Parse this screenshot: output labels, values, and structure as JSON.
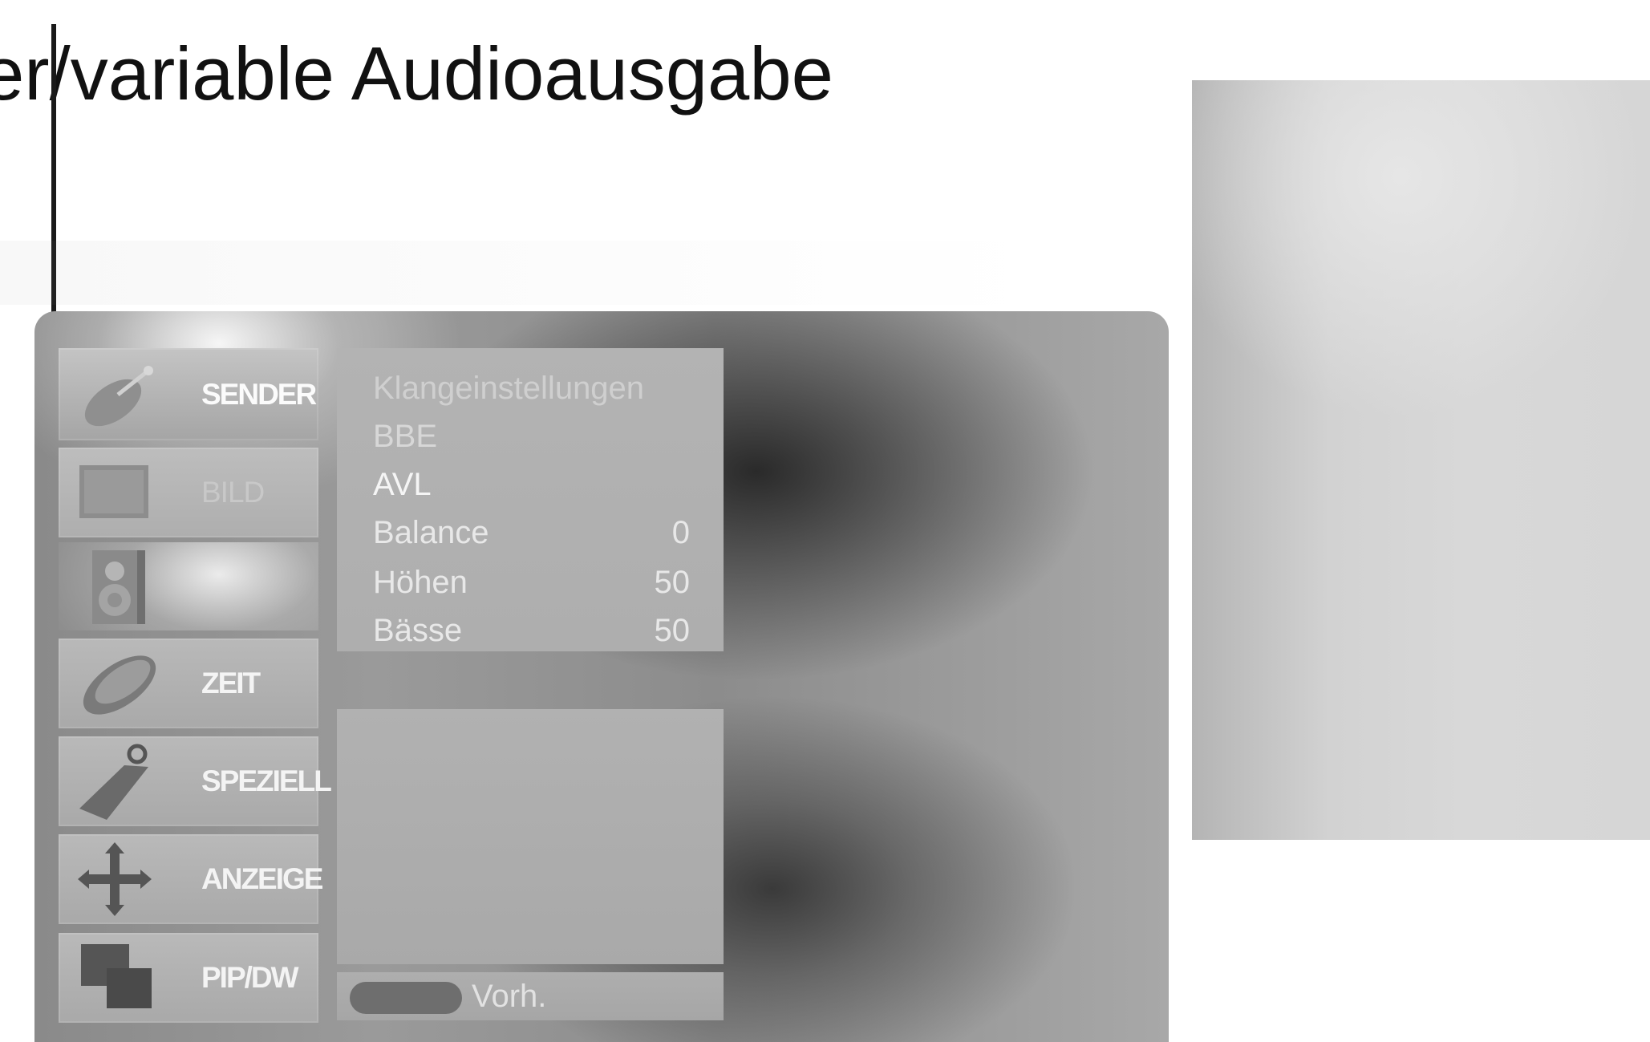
{
  "heading": {
    "text": "er/variable Audioausgabe"
  },
  "osd": {
    "categories": [
      {
        "label": "SENDER",
        "icon": "satellite-dish-icon"
      },
      {
        "label": "BILD",
        "icon": "screen-icon"
      },
      {
        "label": "",
        "icon": "speaker-icon"
      },
      {
        "label": "ZEIT",
        "icon": "clock-disc-icon"
      },
      {
        "label": "SPEZIELL",
        "icon": "key-tag-icon"
      },
      {
        "label": "ANZEIGE",
        "icon": "move-arrows-icon"
      },
      {
        "label": "PIP/DW",
        "icon": "pip-screens-icon"
      }
    ],
    "submenu": {
      "title": "Klangeinstellungen",
      "rows": [
        {
          "label": "BBE",
          "value": ""
        },
        {
          "label": "AVL",
          "value": ""
        },
        {
          "label": "Balance",
          "value": "0"
        },
        {
          "label": "Höhen",
          "value": "50"
        },
        {
          "label": "Bässe",
          "value": "50"
        }
      ]
    },
    "bottom_bar": {
      "label": "Vorh."
    }
  }
}
